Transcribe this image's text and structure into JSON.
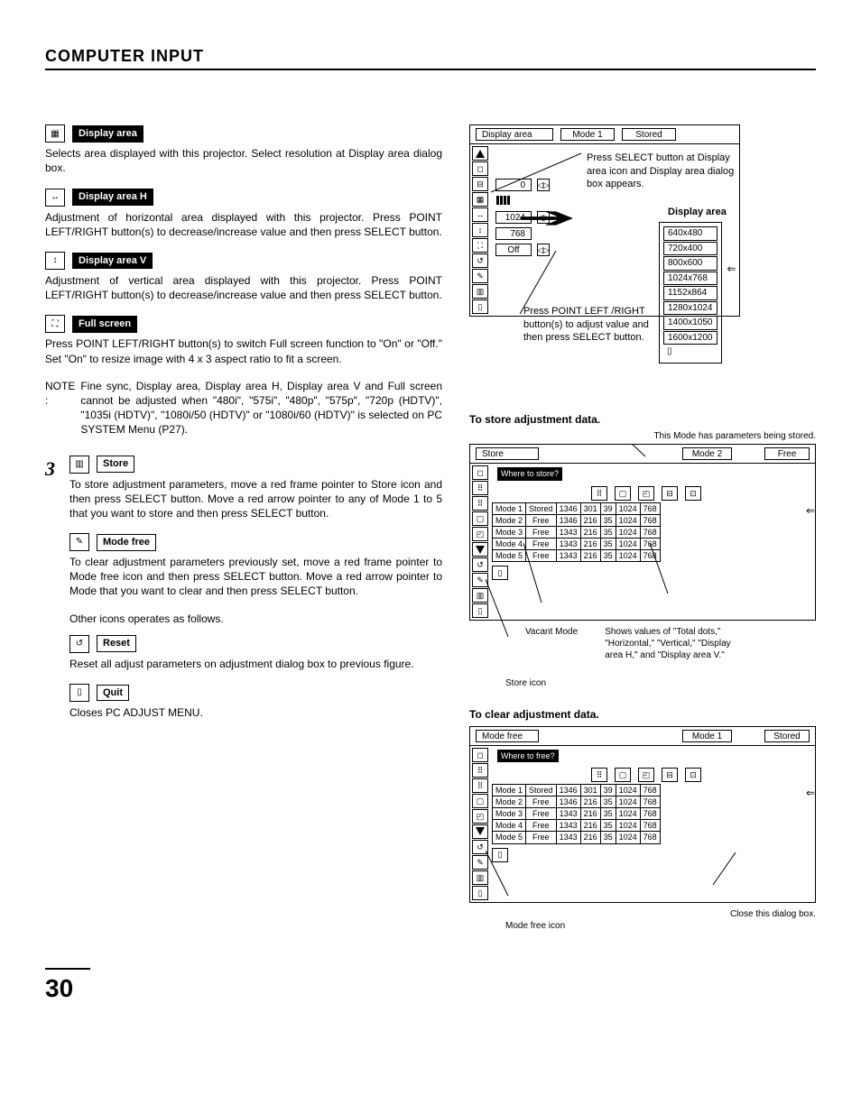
{
  "page": {
    "title": "COMPUTER INPUT",
    "number": "30"
  },
  "left": {
    "display_area": {
      "label": "Display area",
      "text": "Selects area displayed with this projector.  Select resolution at Display area dialog box."
    },
    "display_area_h": {
      "label": "Display area H",
      "text": "Adjustment of horizontal area displayed with this projector.  Press POINT LEFT/RIGHT button(s) to decrease/increase value and then press SELECT button."
    },
    "display_area_v": {
      "label": "Display area V",
      "text": "Adjustment of vertical area displayed with this projector.  Press POINT LEFT/RIGHT button(s) to decrease/increase value and then press SELECT button."
    },
    "full_screen": {
      "label": "Full screen",
      "text": "Press POINT LEFT/RIGHT button(s) to switch Full screen function to \"On\" or \"Off.\"  Set \"On\" to resize image with 4 x 3 aspect ratio to fit a screen."
    },
    "note": {
      "prefix": "NOTE :",
      "text": "Fine sync, Display area, Display area H, Display area V and Full screen cannot be adjusted when \"480i\", \"575i\", \"480p\", \"575p\", \"720p (HDTV)\", \"1035i (HDTV)\", \"1080i/50 (HDTV)\" or \"1080i/60 (HDTV)\" is selected on PC SYSTEM Menu (P27)."
    },
    "step3": "3",
    "store": {
      "label": "Store",
      "text": "To store adjustment parameters, move a red frame pointer to Store icon and then press SELECT button.  Move a red arrow pointer to any of Mode 1 to 5 that you want to store and then press SELECT button."
    },
    "mode_free": {
      "label": "Mode free",
      "text": "To clear adjustment parameters previously set, move a red frame pointer to Mode free icon and then press SELECT button.  Move a red arrow pointer to Mode that you want to clear and then press SELECT button."
    },
    "other": "Other icons operates as follows.",
    "reset": {
      "label": "Reset",
      "text": "Reset all adjust parameters on adjustment dialog box to previous figure."
    },
    "quit": {
      "label": "Quit",
      "text": "Closes PC ADJUST MENU."
    }
  },
  "right": {
    "osd1": {
      "title": "Display area",
      "mode": "Mode 1",
      "status": "Stored",
      "vals": {
        "zero": "0",
        "h": "1024",
        "v": "768",
        "fs": "Off"
      },
      "caption1": "Press SELECT button at Display area icon and Display area dialog box appears.",
      "heading": "Display area",
      "resolutions": [
        "640x480",
        "720x400",
        "800x600",
        "1024x768",
        "1152x864",
        "1280x1024",
        "1400x1050",
        "1600x1200"
      ],
      "caption2": "Press POINT LEFT /RIGHT button(s) to adjust value and then press SELECT button."
    },
    "store_section": {
      "heading": "To store adjustment data.",
      "topnote": "This Mode has parameters being stored.",
      "osd_title": "Store",
      "osd_mode": "Mode 2",
      "osd_status": "Free",
      "where": "Where to store?",
      "rows": [
        {
          "m": "Mode 1",
          "s": "Stored",
          "a": "1346",
          "b": "301",
          "c": "39",
          "d": "1024",
          "e": "768"
        },
        {
          "m": "Mode 2",
          "s": "Free",
          "a": "1346",
          "b": "216",
          "c": "35",
          "d": "1024",
          "e": "768"
        },
        {
          "m": "Mode 3",
          "s": "Free",
          "a": "1343",
          "b": "216",
          "c": "35",
          "d": "1024",
          "e": "768"
        },
        {
          "m": "Mode 4",
          "s": "Free",
          "a": "1343",
          "b": "216",
          "c": "35",
          "d": "1024",
          "e": "768"
        },
        {
          "m": "Mode 5",
          "s": "Free",
          "a": "1343",
          "b": "216",
          "c": "35",
          "d": "1024",
          "e": "768"
        }
      ],
      "annot_left": "Vacant Mode",
      "annot_right": "Shows values of \"Total dots,\" \"Horizontal,\" \"Vertical,\" \"Display area H,\" and \"Display area V.\"",
      "annot_store": "Store icon"
    },
    "clear_section": {
      "heading": "To clear adjustment data.",
      "osd_title": "Mode free",
      "osd_mode": "Mode 1",
      "osd_status": "Stored",
      "where": "Where to free?",
      "rows": [
        {
          "m": "Mode 1",
          "s": "Stored",
          "a": "1346",
          "b": "301",
          "c": "39",
          "d": "1024",
          "e": "768"
        },
        {
          "m": "Mode 2",
          "s": "Free",
          "a": "1346",
          "b": "216",
          "c": "35",
          "d": "1024",
          "e": "768"
        },
        {
          "m": "Mode 3",
          "s": "Free",
          "a": "1343",
          "b": "216",
          "c": "35",
          "d": "1024",
          "e": "768"
        },
        {
          "m": "Mode 4",
          "s": "Free",
          "a": "1343",
          "b": "216",
          "c": "35",
          "d": "1024",
          "e": "768"
        },
        {
          "m": "Mode 5",
          "s": "Free",
          "a": "1343",
          "b": "216",
          "c": "35",
          "d": "1024",
          "e": "768"
        }
      ],
      "annot_close": "Close this dialog box.",
      "annot_mf": "Mode free icon"
    }
  }
}
